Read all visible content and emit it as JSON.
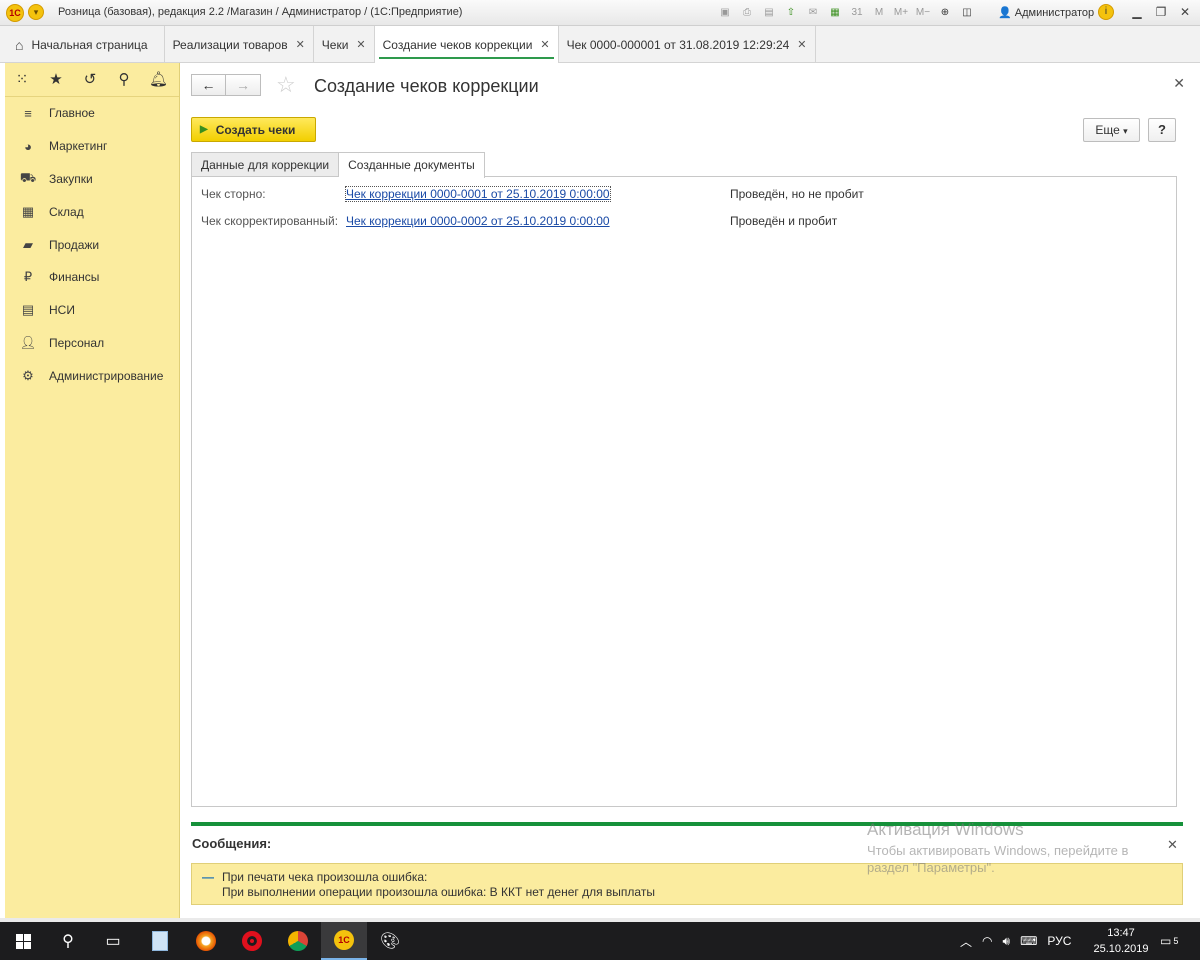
{
  "window": {
    "logo": "1С",
    "title": "Розница (базовая), редакция 2.2 /Магазин / Администратор /  (1С:Предприятие)",
    "toolbar_icons": [
      "save-icon",
      "print-icon",
      "preview-icon",
      "import-icon",
      "export-icon",
      "calculator-icon",
      "calendar-icon",
      "M",
      "M+",
      "M-",
      "zoom-icon",
      "panel-icon"
    ],
    "toolbar_labels": {
      "m": "M",
      "mplus": "M+",
      "mminus": "M−",
      "calendar": "31"
    },
    "user": "Администратор",
    "info": "i"
  },
  "tabs": [
    {
      "label": "Начальная страница",
      "closable": false
    },
    {
      "label": "Реализации товаров",
      "closable": true
    },
    {
      "label": "Чеки",
      "closable": true
    },
    {
      "label": "Создание чеков коррекции",
      "closable": true,
      "active": true
    },
    {
      "label": "Чек 0000-000001 от 31.08.2019 12:29:24",
      "closable": true
    }
  ],
  "sidebar": {
    "items": [
      {
        "label": "Главное",
        "icon": "menu-icon"
      },
      {
        "label": "Маркетинг",
        "icon": "pie-chart-icon"
      },
      {
        "label": "Закупки",
        "icon": "cart-icon"
      },
      {
        "label": "Склад",
        "icon": "warehouse-icon"
      },
      {
        "label": "Продажи",
        "icon": "sales-icon"
      },
      {
        "label": "Финансы",
        "icon": "ruble-icon"
      },
      {
        "label": "НСИ",
        "icon": "reference-icon"
      },
      {
        "label": "Персонал",
        "icon": "person-icon"
      },
      {
        "label": "Администрирование",
        "icon": "gear-icon"
      }
    ]
  },
  "form": {
    "title": "Создание чеков коррекции",
    "create_button": "Создать чеки",
    "more_button": "Еще",
    "help_button": "?",
    "tabs": [
      "Данные для коррекции",
      "Созданные документы"
    ],
    "rows": [
      {
        "label": "Чек сторно:",
        "link": "Чек коррекции 0000-0001 от 25.10.2019 0:00:00",
        "status": "Проведён, но не пробит"
      },
      {
        "label": "Чек скорректированный:",
        "link": "Чек коррекции 0000-0002 от 25.10.2019 0:00:00",
        "status": "Проведён и пробит"
      }
    ]
  },
  "messages": {
    "title": "Сообщения:",
    "line1": "При печати чека произошла ошибка:",
    "line2": "При выполнении операции произошла ошибка: В ККТ нет денег для выплаты"
  },
  "watermark": {
    "line1": "Активация Windows",
    "line2": "Чтобы активировать Windows, перейдите в",
    "line3": "раздел \"Параметры\"."
  },
  "taskbar": {
    "language": "РУС",
    "time": "13:47",
    "date": "25.10.2019",
    "notifications": "5",
    "app_1c": "1С"
  },
  "colors": {
    "sidebar_bg": "#fbec9f",
    "accent_green": "#16913a",
    "create_button": "#f7d618",
    "link": "#1a4aa6"
  }
}
